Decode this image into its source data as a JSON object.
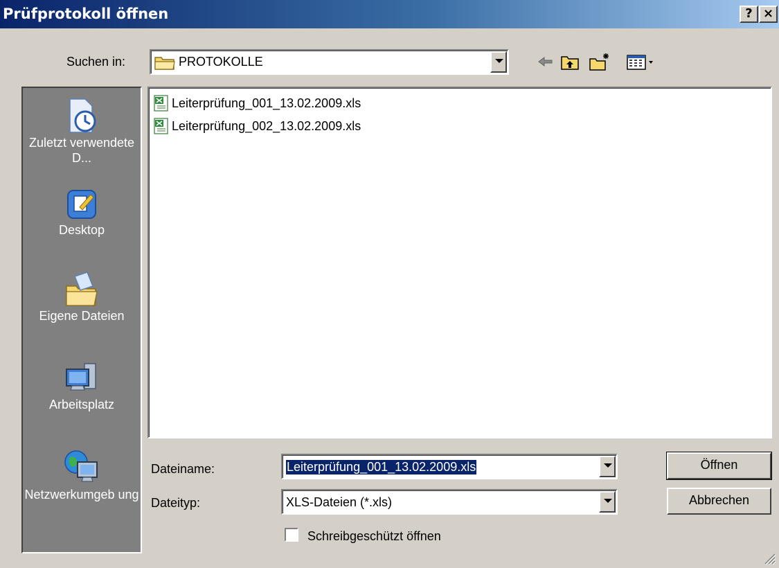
{
  "window": {
    "title": "Prüfprotokoll öffnen",
    "help_button": "?",
    "close_button": "×"
  },
  "lookin": {
    "label": "Suchen in:",
    "value": "PROTOKOLLE"
  },
  "toolbar": {
    "icons": [
      "back-icon",
      "up-folder-icon",
      "new-folder-icon",
      "view-menu-icon"
    ]
  },
  "places": [
    {
      "label": "Zuletzt verwendete D...",
      "icon": "recent-documents-icon"
    },
    {
      "label": "Desktop",
      "icon": "desktop-icon"
    },
    {
      "label": "Eigene Dateien",
      "icon": "my-documents-icon"
    },
    {
      "label": "Arbeitsplatz",
      "icon": "my-computer-icon"
    },
    {
      "label": "Netzwerkumgeb ung",
      "icon": "network-icon"
    }
  ],
  "files": [
    {
      "name": "Leiterprüfung_001_13.02.2009.xls",
      "icon": "excel-file-icon"
    },
    {
      "name": "Leiterprüfung_002_13.02.2009.xls",
      "icon": "excel-file-icon"
    }
  ],
  "filename": {
    "label": "Dateiname:",
    "value": "Leiterprüfung_001_13.02.2009.xls"
  },
  "filetype": {
    "label": "Dateityp:",
    "value": "XLS-Dateien (*.xls)"
  },
  "readonly": {
    "label": "Schreibgeschützt öffnen",
    "checked": false
  },
  "buttons": {
    "open": "Öffnen",
    "cancel": "Abbrechen"
  },
  "colors": {
    "titlebar_start": "#0a246a",
    "titlebar_end": "#a6caf0",
    "dialog_bg": "#d4d0c8",
    "places_bg": "#808080",
    "selection": "#0a246a"
  }
}
